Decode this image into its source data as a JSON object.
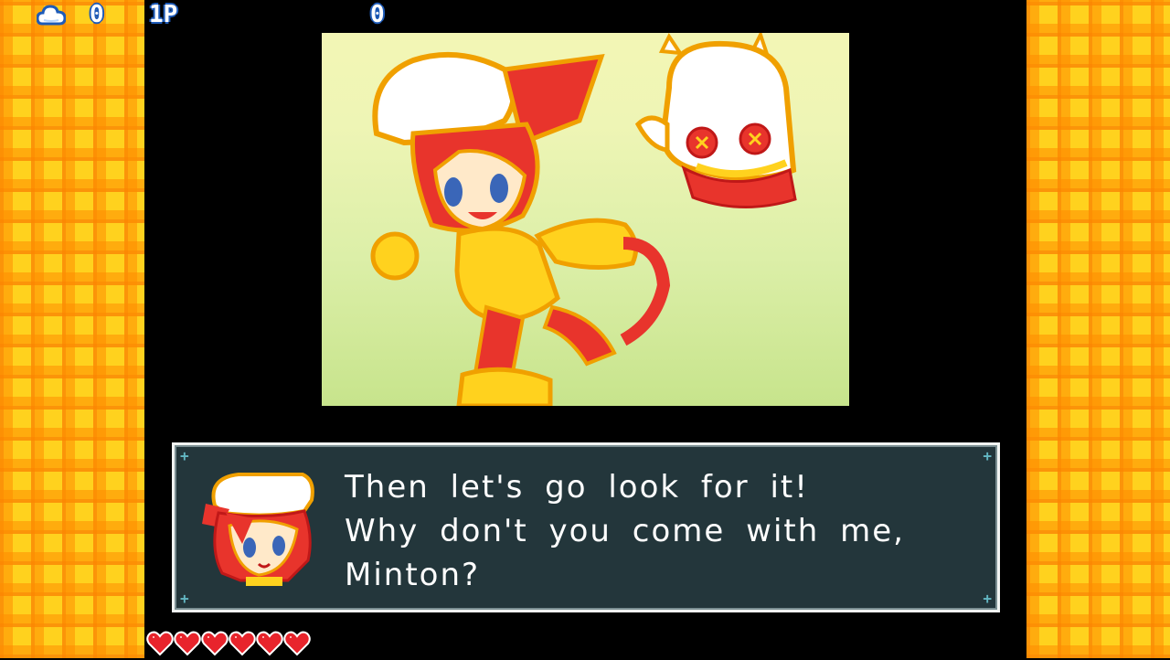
{
  "hud": {
    "cloud_count": "0",
    "player_label": "1P",
    "score": "0",
    "cloud_icon": "cloud-icon"
  },
  "cutscene": {
    "illustration": "cutscene-illustration"
  },
  "dialog": {
    "lines": [
      "Then let's go look for it!",
      "Why don't you come with me,",
      "Minton?"
    ],
    "speaker_portrait_icon": "speaker-portrait"
  },
  "health": {
    "hearts": 6,
    "max_hearts": 6,
    "heart_icon": "heart-icon"
  },
  "colors": {
    "border_yellow": "#ffd21e",
    "border_orange": "#ff8c00",
    "dialog_bg": "#23363b",
    "heart_red": "#e8242c",
    "hud_outline": "#1e5bb8"
  }
}
